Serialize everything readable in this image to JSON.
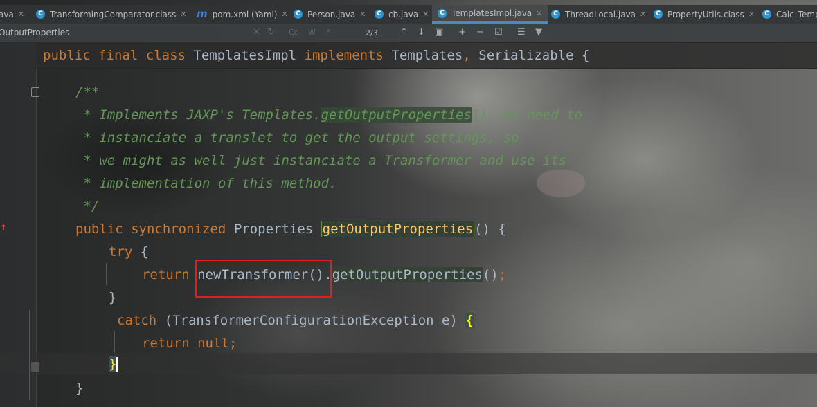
{
  "tabs": [
    {
      "label": "ava",
      "icon": "none"
    },
    {
      "label": "TransformingComparator.class",
      "icon": "class-icon"
    },
    {
      "label": "pom.xml (Yaml)",
      "icon": "maven-icon"
    },
    {
      "label": "Person.java",
      "icon": "class-icon"
    },
    {
      "label": "cb.java",
      "icon": "class-icon"
    },
    {
      "label": "TemplatesImpl.java",
      "icon": "class-icon",
      "active": true
    },
    {
      "label": "ThreadLocal.java",
      "icon": "class-icon"
    },
    {
      "label": "PropertyUtils.class",
      "icon": "class-icon"
    },
    {
      "label": "Calc_Temp",
      "icon": "class-icon"
    }
  ],
  "tab_icon_letters": {
    "class": "C",
    "maven": "m"
  },
  "find": {
    "query": "OutputProperties",
    "match_count": "2/3"
  },
  "code": {
    "sticky_line": [
      "public",
      "final",
      "class",
      "TemplatesImpl",
      "implements",
      "Templates",
      "Serializable"
    ],
    "doc": {
      "open": "/**",
      "l1a": " * Implements JAXP's Templates.",
      "l1_ref": "getOutputProperties",
      "l1b": "(). We need to",
      "l2": " * instanciate a translet to get the output settings, so",
      "l3": " * we might as well just instanciate a Transformer and use its",
      "l4": " * implementation of this method.",
      "close": " */"
    },
    "method_sig": {
      "mod1": "public",
      "mod2": "synchronized",
      "type": "Properties",
      "name": "getOutputProperties",
      "rest": "() {"
    },
    "try_kw": "try",
    "return_kw": "return",
    "call1": "newTransformer()",
    "call2": "getOutputProperties",
    "catch_kw": "catch",
    "exception": "(TransformerConfigurationException e)",
    "null_kw": "null",
    "brace_open": "{",
    "brace_close": "}"
  },
  "colors": {
    "keyword": "#cc7832",
    "doc_comment": "#629755",
    "method_decl": "#ffc66d",
    "annotation_box": "#e02020",
    "active_tab_underline": "#4a88c7"
  }
}
